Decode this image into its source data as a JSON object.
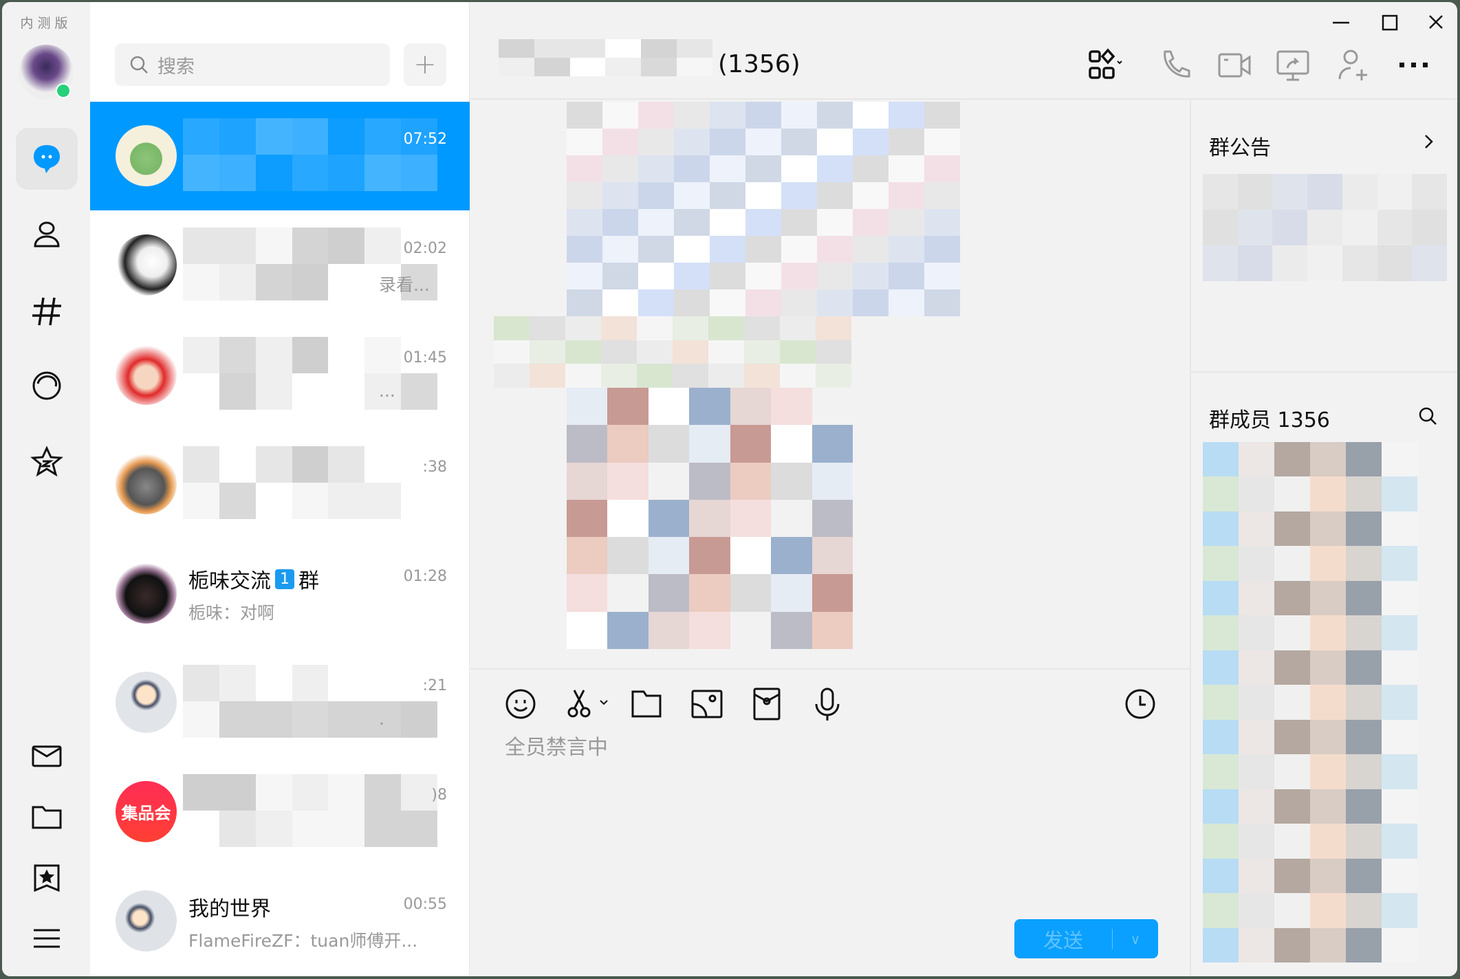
{
  "rail": {
    "badge_text": "内测版",
    "items": [
      {
        "icon": "chat-bubble-icon",
        "active": true
      },
      {
        "icon": "contacts-icon"
      },
      {
        "icon": "channel-hash-icon"
      },
      {
        "icon": "moments-icon"
      },
      {
        "icon": "qzone-star-icon"
      }
    ],
    "bottom_items": [
      {
        "icon": "mail-icon"
      },
      {
        "icon": "folder-icon"
      },
      {
        "icon": "favorites-icon"
      },
      {
        "icon": "menu-icon"
      }
    ]
  },
  "search": {
    "placeholder": "搜索",
    "add_label": "+"
  },
  "chats": [
    {
      "name": "",
      "preview": "",
      "time": "07:52",
      "selected": true,
      "avatar": "crocodile"
    },
    {
      "name": "",
      "preview": "录看...",
      "time": "02:02",
      "avatar": "meme"
    },
    {
      "name": "",
      "preview": "...",
      "time": "01:45",
      "avatar": "red-fox"
    },
    {
      "name": "",
      "preview": "",
      "time": ":38",
      "avatar": "raccoon"
    },
    {
      "name": "栀味交流",
      "badge": "1",
      "name_suffix": "群",
      "preview": "栀味：对啊",
      "time": "01:28",
      "avatar": "cartoon-girl"
    },
    {
      "name": "",
      "preview": ".",
      "time": ":21",
      "avatar": "default-user"
    },
    {
      "name": "",
      "preview": "",
      "time": ")8",
      "avatar": "jipinhui"
    },
    {
      "name": "我的世界",
      "preview": "FlameFireZF：tuan师傅开...",
      "time": "00:55",
      "avatar": "default-group"
    }
  ],
  "avatar_text": {
    "jipinhui": "集品会"
  },
  "header": {
    "member_count_label": "(1356)"
  },
  "right": {
    "notice_title": "群公告",
    "members_title": "群成员 1356"
  },
  "input": {
    "muted_text": "全员禁言中",
    "send_label": "发送"
  },
  "colors": {
    "accent": "#0099ff",
    "send": "#0aa0ff",
    "online": "#27d07a"
  }
}
